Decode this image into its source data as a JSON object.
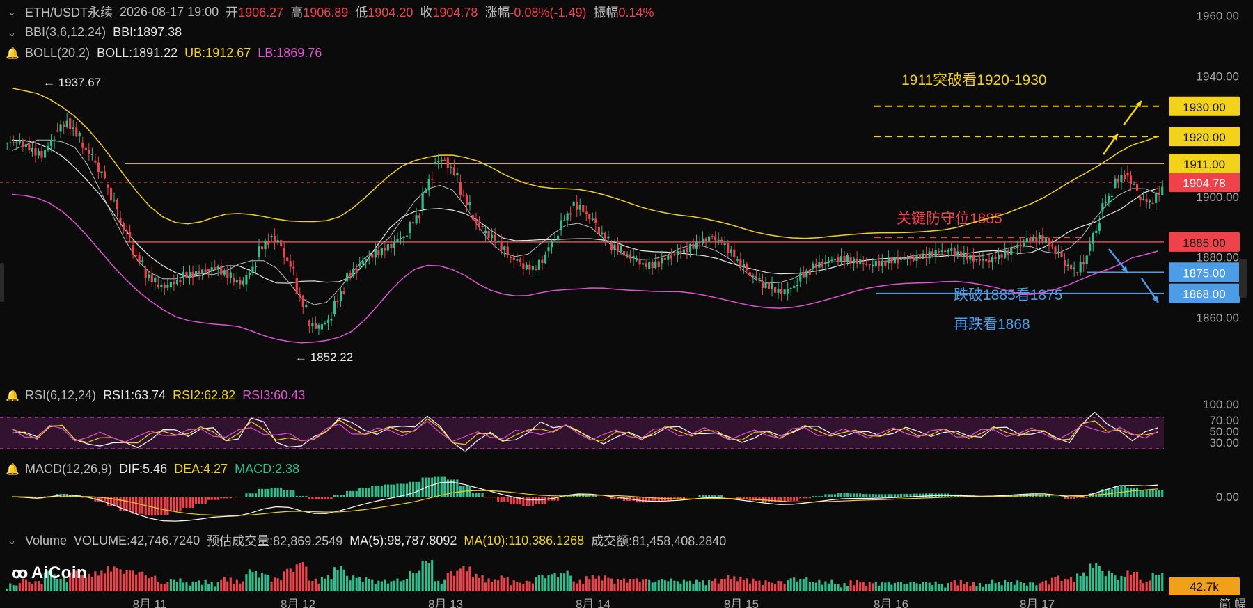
{
  "header": {
    "symbol": "ETH/USDT永续",
    "datetime": "2026-08-17 19:00",
    "open_label": "开",
    "open": "1906.27",
    "high_label": "高",
    "high": "1906.89",
    "low_label": "低",
    "low": "1904.20",
    "close_label": "收",
    "close": "1904.78",
    "change_label": "涨幅",
    "change": "-0.08%(-1.49)",
    "amp_label": "振幅",
    "amp": "0.14%"
  },
  "indicators": {
    "bbi_label": "BBI(3,6,12,24)",
    "bbi_value": "BBI:1897.38",
    "boll_label": "BOLL(20,2)",
    "boll_mid": "BOLL:1891.22",
    "boll_ub": "UB:1912.67",
    "boll_lb": "LB:1869.76",
    "rsi_label": "RSI(6,12,24)",
    "rsi1": "RSI1:63.74",
    "rsi2": "RSI2:62.82",
    "rsi3": "RSI3:60.43",
    "macd_label": "MACD(12,26,9)",
    "dif": "DIF:5.46",
    "dea": "DEA:4.27",
    "macd": "MACD:2.38",
    "vol_label": "Volume",
    "volume": "VOLUME:42,746.7240",
    "est_volume": "预估成交量:82,869.2549",
    "ma5": "MA(5):98,787.8092",
    "ma10": "MA(10):110,386.1268",
    "turnover": "成交额:81,458,408.2840"
  },
  "logo": "AiCoin",
  "colors": {
    "up": "#2fbf8f",
    "down": "#f0424b",
    "ub": "#f2d21b",
    "lb": "#e052d2",
    "mid": "#e8e8e8",
    "support_blue": "#4c9ce8",
    "bg": "#0b0b0c"
  },
  "chart_data": {
    "type": "candlestick",
    "price_axis": {
      "min": 1855,
      "max": 1962,
      "ticks": [
        "1960.00",
        "1940.00",
        "1920.00",
        "1900.00",
        "1880.00",
        "1860.00"
      ]
    },
    "x_ticks": [
      "8月 11",
      "8月 12",
      "8月 13",
      "8月 14",
      "8月 15",
      "8月 16",
      "8月 17"
    ],
    "extremes": {
      "high": "1937.67",
      "low": "1852.22"
    },
    "levels": [
      {
        "value": 1930,
        "label": "1930.00",
        "color": "#f2d21b",
        "style": "dashed"
      },
      {
        "value": 1920,
        "label": "1920.00",
        "color": "#f2d21b",
        "style": "dashed"
      },
      {
        "value": 1911,
        "label": "1911.00",
        "color": "#f2d21b",
        "style": "solid"
      },
      {
        "value": 1904.78,
        "label": "1904.78",
        "color": "#f0424b",
        "style": "current"
      },
      {
        "value": 1885,
        "label": "1885.00",
        "color": "#f0424b",
        "style": "solid"
      },
      {
        "value": 1875,
        "label": "1875.00",
        "color": "#4c9ce8",
        "style": "solid"
      },
      {
        "value": 1868,
        "label": "1868.00",
        "color": "#4c9ce8",
        "style": "solid"
      }
    ],
    "annotations": [
      "1911突破看1920-1930",
      "关键防守位1885",
      "跌破1885看1875",
      "再跌看1868"
    ],
    "close_path": [
      1918,
      1915,
      1913,
      1922,
      1926,
      1918,
      1912,
      1904,
      1893,
      1884,
      1876,
      1871,
      1870,
      1873,
      1874,
      1876,
      1877,
      1873,
      1871,
      1880,
      1887,
      1883,
      1873,
      1859,
      1856,
      1861,
      1872,
      1877,
      1881,
      1883,
      1885,
      1888,
      1896,
      1911,
      1913,
      1905,
      1894,
      1888,
      1885,
      1880,
      1878,
      1876,
      1882,
      1889,
      1897,
      1895,
      1890,
      1885,
      1882,
      1879,
      1876,
      1878,
      1881,
      1883,
      1885,
      1887,
      1884,
      1879,
      1875,
      1872,
      1870,
      1868,
      1872,
      1876,
      1878,
      1880,
      1880,
      1878,
      1877,
      1878,
      1879,
      1880,
      1881,
      1882,
      1882,
      1880,
      1879,
      1879,
      1881,
      1883,
      1885,
      1886,
      1884,
      1879,
      1875,
      1882,
      1895,
      1903,
      1908,
      1900,
      1898,
      1904.78
    ],
    "rsi_axis": {
      "ticks": [
        "100.00",
        "70.00",
        "50.00",
        "30.00"
      ]
    },
    "macd_axis": {
      "ticks": [
        "0.00"
      ]
    },
    "volume_axis": {
      "last": "42.7k"
    }
  },
  "footer": {
    "corner": "简 幅"
  }
}
